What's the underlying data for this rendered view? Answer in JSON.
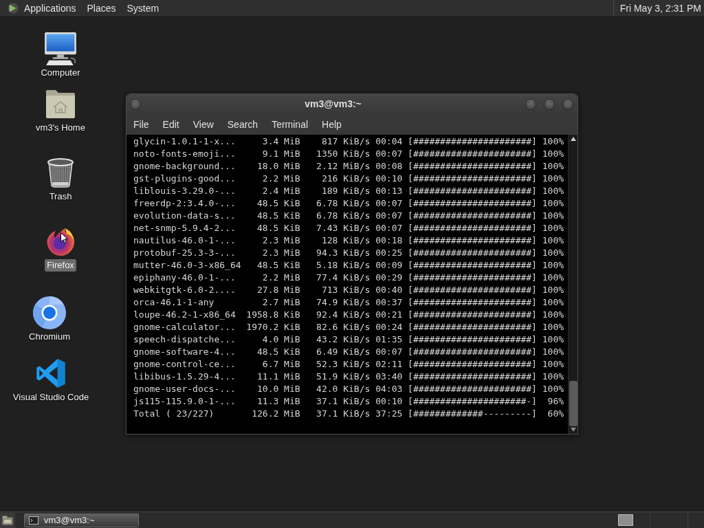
{
  "top_panel": {
    "menus": [
      "Applications",
      "Places",
      "System"
    ],
    "clock": "Fri May 3, 2:31 PM"
  },
  "desktop_icons": [
    {
      "kind": "computer",
      "label": "Computer",
      "selected": false
    },
    {
      "kind": "home",
      "label": "vm3's Home",
      "selected": false
    },
    {
      "kind": "trash",
      "label": "Trash",
      "selected": false
    },
    {
      "kind": "firefox",
      "label": "Firefox",
      "selected": true
    },
    {
      "kind": "chromium",
      "label": "Chromium",
      "selected": false
    },
    {
      "kind": "vscode",
      "label": "Visual Studio Code",
      "selected": false
    }
  ],
  "terminal": {
    "title": "vm3@vm3:~",
    "menu": [
      "File",
      "Edit",
      "View",
      "Search",
      "Terminal",
      "Help"
    ],
    "rows": [
      {
        "package": "glycin-1.0.1-1-x...",
        "size": "3.4 MiB",
        "rate": "817 KiB/s",
        "eta": "00:04",
        "bar": "[######################]",
        "percent": "100%"
      },
      {
        "package": "noto-fonts-emoji...",
        "size": "9.1 MiB",
        "rate": "1350 KiB/s",
        "eta": "00:07",
        "bar": "[######################]",
        "percent": "100%"
      },
      {
        "package": "gnome-background...",
        "size": "18.0 MiB",
        "rate": "2.12 MiB/s",
        "eta": "00:08",
        "bar": "[######################]",
        "percent": "100%"
      },
      {
        "package": "gst-plugins-good...",
        "size": "2.2 MiB",
        "rate": "216 KiB/s",
        "eta": "00:10",
        "bar": "[######################]",
        "percent": "100%"
      },
      {
        "package": "liblouis-3.29.0-...",
        "size": "2.4 MiB",
        "rate": "189 KiB/s",
        "eta": "00:13",
        "bar": "[######################]",
        "percent": "100%"
      },
      {
        "package": "freerdp-2:3.4.0-...",
        "size": "48.5 KiB",
        "rate": "6.78 KiB/s",
        "eta": "00:07",
        "bar": "[######################]",
        "percent": "100%"
      },
      {
        "package": "evolution-data-s...",
        "size": "48.5 KiB",
        "rate": "6.78 KiB/s",
        "eta": "00:07",
        "bar": "[######################]",
        "percent": "100%"
      },
      {
        "package": "net-snmp-5.9.4-2...",
        "size": "48.5 KiB",
        "rate": "7.43 KiB/s",
        "eta": "00:07",
        "bar": "[######################]",
        "percent": "100%"
      },
      {
        "package": "nautilus-46.0-1-...",
        "size": "2.3 MiB",
        "rate": "128 KiB/s",
        "eta": "00:18",
        "bar": "[######################]",
        "percent": "100%"
      },
      {
        "package": "protobuf-25.3-3-...",
        "size": "2.3 MiB",
        "rate": "94.3 KiB/s",
        "eta": "00:25",
        "bar": "[######################]",
        "percent": "100%"
      },
      {
        "package": "mutter-46.0-3-x86_64",
        "size": "48.5 KiB",
        "rate": "5.18 KiB/s",
        "eta": "00:09",
        "bar": "[######################]",
        "percent": "100%"
      },
      {
        "package": "epiphany-46.0-1-...",
        "size": "2.2 MiB",
        "rate": "77.4 KiB/s",
        "eta": "00:29",
        "bar": "[######################]",
        "percent": "100%"
      },
      {
        "package": "webkitgtk-6.0-2....",
        "size": "27.8 MiB",
        "rate": "713 KiB/s",
        "eta": "00:40",
        "bar": "[######################]",
        "percent": "100%"
      },
      {
        "package": "orca-46.1-1-any",
        "size": "2.7 MiB",
        "rate": "74.9 KiB/s",
        "eta": "00:37",
        "bar": "[######################]",
        "percent": "100%"
      },
      {
        "package": "loupe-46.2-1-x86_64",
        "size": "1958.8 KiB",
        "rate": "92.4 KiB/s",
        "eta": "00:21",
        "bar": "[######################]",
        "percent": "100%"
      },
      {
        "package": "gnome-calculator...",
        "size": "1970.2 KiB",
        "rate": "82.6 KiB/s",
        "eta": "00:24",
        "bar": "[######################]",
        "percent": "100%"
      },
      {
        "package": "speech-dispatche...",
        "size": "4.0 MiB",
        "rate": "43.2 KiB/s",
        "eta": "01:35",
        "bar": "[######################]",
        "percent": "100%"
      },
      {
        "package": "gnome-software-4...",
        "size": "48.5 KiB",
        "rate": "6.49 KiB/s",
        "eta": "00:07",
        "bar": "[######################]",
        "percent": "100%"
      },
      {
        "package": "gnome-control-ce...",
        "size": "6.7 MiB",
        "rate": "52.3 KiB/s",
        "eta": "02:11",
        "bar": "[######################]",
        "percent": "100%"
      },
      {
        "package": "libibus-1.5.29-4...",
        "size": "11.1 MiB",
        "rate": "51.9 KiB/s",
        "eta": "03:40",
        "bar": "[######################]",
        "percent": "100%"
      },
      {
        "package": "gnome-user-docs-...",
        "size": "10.0 MiB",
        "rate": "42.0 KiB/s",
        "eta": "04:03",
        "bar": "[######################]",
        "percent": "100%"
      },
      {
        "package": "js115-115.9.0-1-...",
        "size": "11.3 MiB",
        "rate": "37.1 KiB/s",
        "eta": "00:10",
        "bar": "[#####################-]",
        "percent": "96%"
      },
      {
        "package": "Total ( 23/227)",
        "size": "126.2 MiB",
        "rate": "37.1 KiB/s",
        "eta": "37:25",
        "bar": "[#############---------]",
        "percent": "60%"
      }
    ]
  },
  "taskbar": {
    "windows": [
      {
        "title": "vm3@vm3:~"
      }
    ]
  }
}
